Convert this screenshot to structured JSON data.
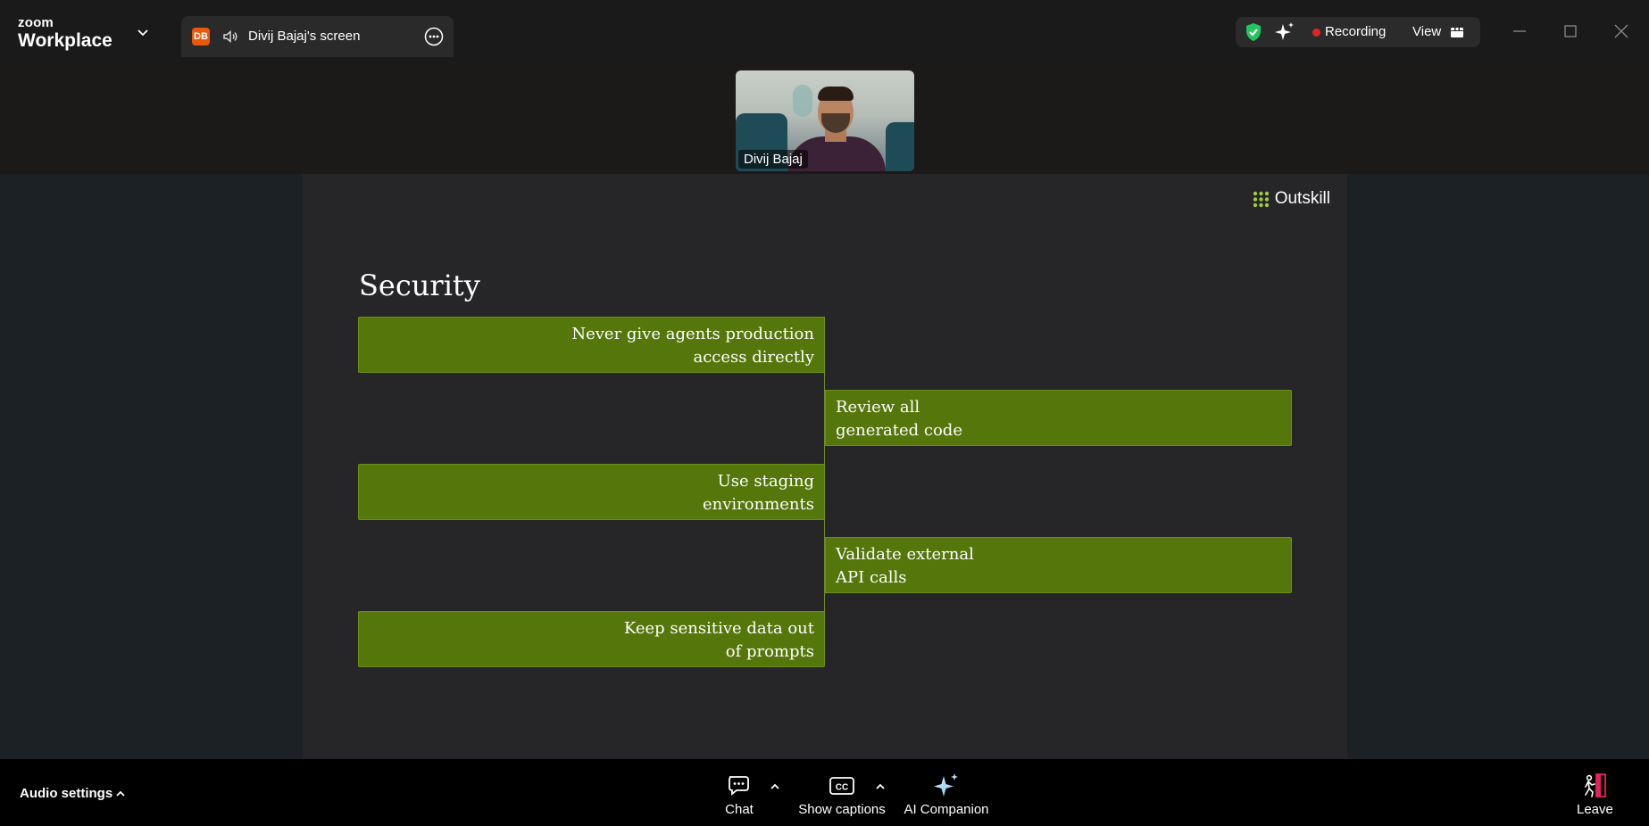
{
  "app": {
    "brand_small": "zoom",
    "brand_large": "Workplace"
  },
  "tab": {
    "initials": "DB",
    "title": "Divij Bajaj's screen"
  },
  "status": {
    "recording_label": "Recording",
    "view_label": "View",
    "recording_color": "#e02424",
    "shield_color": "#22c55e"
  },
  "participant": {
    "name": "Divij Bajaj"
  },
  "slide": {
    "logo_text": "Outskill",
    "title": "Security",
    "accent_color": "#55760b",
    "items": [
      {
        "line1": "Never give agents production",
        "line2": "access directly"
      },
      {
        "line1": "Review all",
        "line2": "generated code"
      },
      {
        "line1": "Use staging",
        "line2": "environments"
      },
      {
        "line1": "Validate external",
        "line2": "API calls"
      },
      {
        "line1": "Keep sensitive data out",
        "line2": "of prompts"
      }
    ]
  },
  "toolbar": {
    "audio_settings_label": "Audio settings",
    "chat_label": "Chat",
    "captions_label": "Show captions",
    "ai_companion_label": "AI Companion",
    "leave_label": "Leave",
    "leave_color": "#e0245e"
  }
}
